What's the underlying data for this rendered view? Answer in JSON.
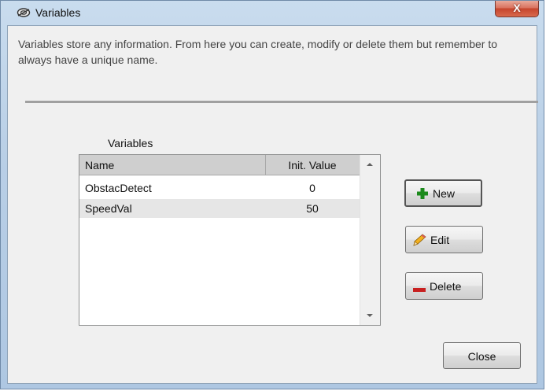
{
  "window": {
    "title": "Variables",
    "close_glyph": "X",
    "title_icon": "cloud-icon"
  },
  "description": "Variables store any information. From here you can create, modify or delete them but remember to always have a unique name.",
  "list": {
    "caption": "Variables",
    "columns": [
      "Name",
      "Init. Value"
    ],
    "rows": [
      {
        "name": "ObstacDetect",
        "value": "0"
      },
      {
        "name": "SpeedVal",
        "value": "50"
      }
    ],
    "selected_row": 1
  },
  "buttons": {
    "new_label": "New",
    "edit_label": "Edit",
    "delete_label": "Delete",
    "close_label": "Close"
  },
  "icons": {
    "new": "plus-icon",
    "edit": "pencil-icon",
    "delete": "minus-icon"
  },
  "colors": {
    "plus": "#1c8a1c",
    "minus": "#c82020",
    "close_button": "#c6452d"
  }
}
